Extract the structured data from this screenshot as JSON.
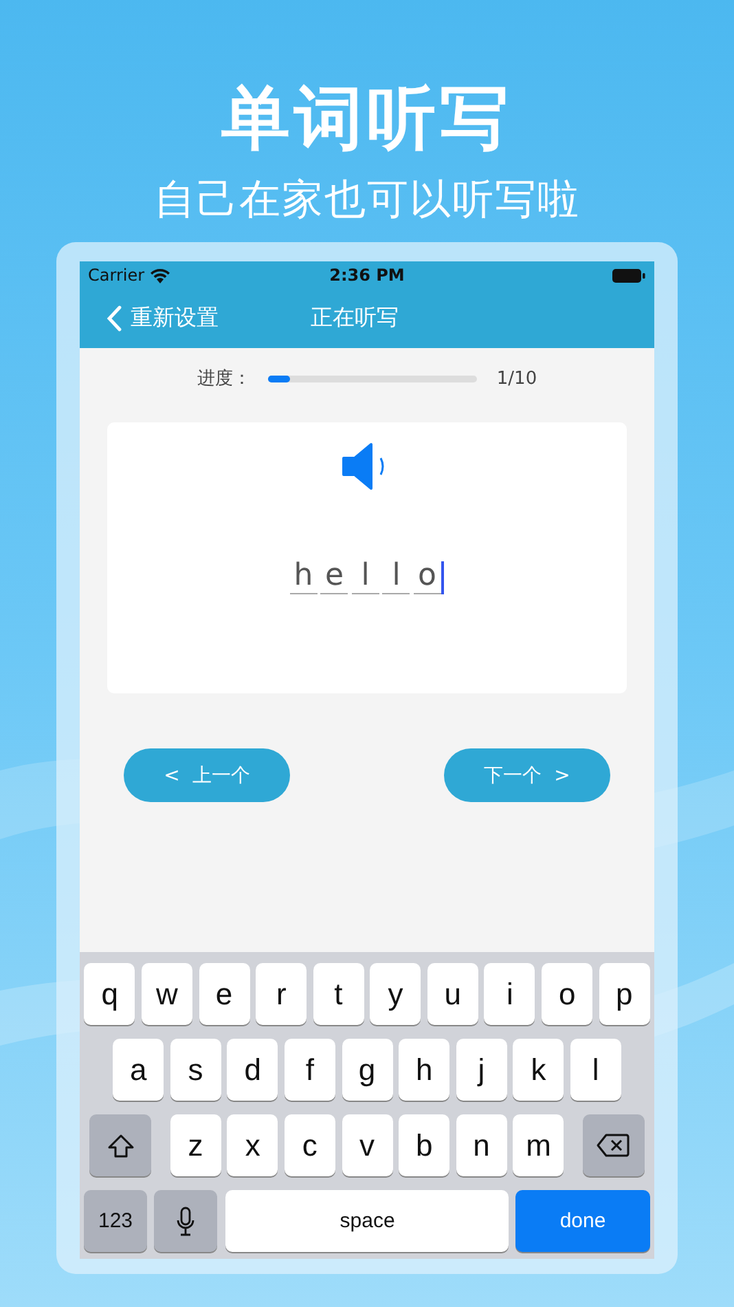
{
  "promo": {
    "title": "单词听写",
    "subtitle": "自己在家也可以听写啦"
  },
  "status_bar": {
    "carrier": "Carrier",
    "time": "2:36 PM"
  },
  "nav": {
    "back": "重新设置",
    "title": "正在听写"
  },
  "progress": {
    "label": "进度：",
    "level": 0.1,
    "count": "1/10"
  },
  "answer": {
    "letters": [
      "h",
      "e",
      "l",
      "l",
      "o"
    ]
  },
  "buttons": [
    {
      "label": "<  上一个"
    },
    {
      "label": "下一个  >"
    }
  ],
  "keyboard": [
    [
      {
        "kind": "letter",
        "label": "q"
      },
      {
        "kind": "letter",
        "label": "w"
      },
      {
        "kind": "letter",
        "label": "e"
      },
      {
        "kind": "letter",
        "label": "r"
      },
      {
        "kind": "letter",
        "label": "t"
      },
      {
        "kind": "letter",
        "label": "y"
      },
      {
        "kind": "letter",
        "label": "u"
      },
      {
        "kind": "letter",
        "label": "i"
      },
      {
        "kind": "letter",
        "label": "o"
      },
      {
        "kind": "letter",
        "label": "p"
      }
    ],
    [
      {
        "kind": "letter",
        "label": "a"
      },
      {
        "kind": "letter",
        "label": "s"
      },
      {
        "kind": "letter",
        "label": "d"
      },
      {
        "kind": "letter",
        "label": "f"
      },
      {
        "kind": "letter",
        "label": "g"
      },
      {
        "kind": "letter",
        "label": "h"
      },
      {
        "kind": "letter",
        "label": "j"
      },
      {
        "kind": "letter",
        "label": "k"
      },
      {
        "kind": "letter",
        "label": "l"
      }
    ],
    [
      {
        "kind": "shift"
      },
      {
        "kind": "letter",
        "label": "z"
      },
      {
        "kind": "letter",
        "label": "x"
      },
      {
        "kind": "letter",
        "label": "c"
      },
      {
        "kind": "letter",
        "label": "v"
      },
      {
        "kind": "letter",
        "label": "b"
      },
      {
        "kind": "letter",
        "label": "n"
      },
      {
        "kind": "letter",
        "label": "m"
      },
      {
        "kind": "delete"
      }
    ],
    [
      {
        "kind": "numbers",
        "label": "123"
      },
      {
        "kind": "mic"
      },
      {
        "kind": "space",
        "label": "space"
      },
      {
        "kind": "done",
        "label": "done"
      }
    ]
  ]
}
